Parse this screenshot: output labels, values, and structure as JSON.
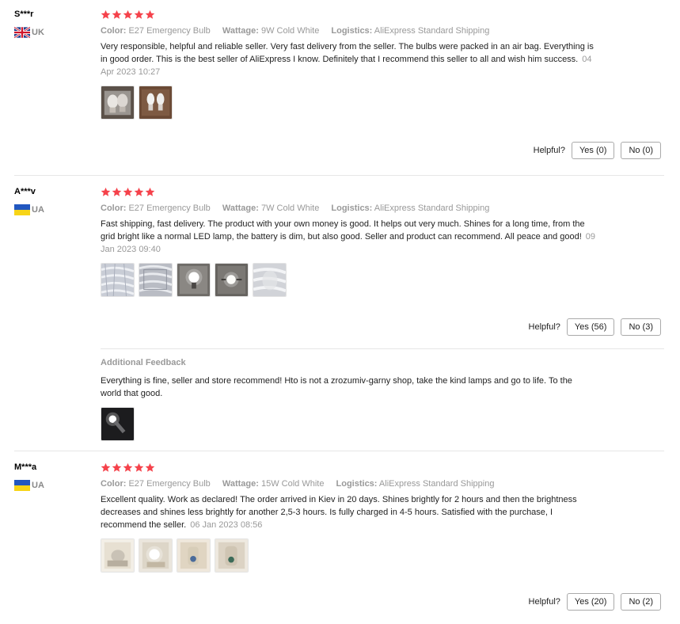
{
  "labels": {
    "color": "Color:",
    "wattage": "Wattage:",
    "logistics": "Logistics:",
    "helpful": "Helpful?",
    "additional_feedback": "Additional Feedback"
  },
  "reviews": [
    {
      "user": "S***r",
      "country": "UK",
      "flag": "uk-flag-icon",
      "rating": 5,
      "color": "E27 Emergency Bulb",
      "wattage": "9W Cold White",
      "logistics": "AliExpress Standard Shipping",
      "text": "Very responsible, helpful and reliable seller. Very fast delivery from the seller. The bulbs were packed in an air bag. Everything is in good order. This is the best seller of AliExpress I know. Definitely that I recommend this seller to all and wish him success.",
      "date": "04 Apr 2023 10:27",
      "yes": "Yes (0)",
      "no": "No (0)"
    },
    {
      "user": "A***v",
      "country": "UA",
      "flag": "ua-flag-icon",
      "rating": 5,
      "color": "E27 Emergency Bulb",
      "wattage": "7W Cold White",
      "logistics": "AliExpress Standard Shipping",
      "text": "Fast shipping, fast delivery. The product with your own money is good. It helps out very much. Shines for a long time, from the grid bright like a normal LED lamp, the battery is dim, but also good. Seller and product can recommend. All peace and good!",
      "date": "09 Jan 2023 09:40",
      "yes": "Yes (56)",
      "no": "No (3)",
      "additional": "Everything is fine, seller and store recommend! Hto is not a zrozumiv-garny shop, take the kind lamps and go to life. To the world that good."
    },
    {
      "user": "M***a",
      "country": "UA",
      "flag": "ua-flag-icon",
      "rating": 5,
      "color": "E27 Emergency Bulb",
      "wattage": "15W Cold White",
      "logistics": "AliExpress Standard Shipping",
      "text": "Excellent quality. Work as declared! The order arrived in Kiev in 20 days. Shines brightly for 2 hours and then the brightness decreases and shines less brightly for another 2,5-3 hours. Is fully charged in 4-5 hours. Satisfied with the purchase, I recommend the seller.",
      "date": "06 Jan 2023 08:56",
      "yes": "Yes (20)",
      "no": "No (2)"
    }
  ],
  "colors": {
    "star": "#f5424b",
    "muted": "#999999",
    "border": "#e6e6e6"
  }
}
